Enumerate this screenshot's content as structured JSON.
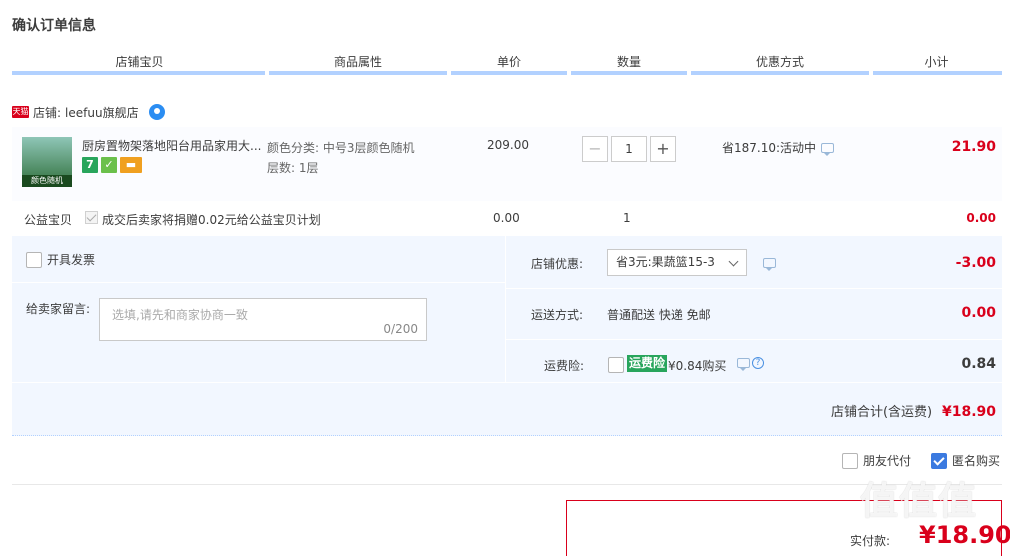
{
  "page_title": "确认订单信息",
  "columns": [
    "店铺宝贝",
    "商品属性",
    "单价",
    "数量",
    "优惠方式",
    "小计"
  ],
  "shop": {
    "tmall_badge": "天猫",
    "label": "店铺:",
    "name": "leefuu旗舰店"
  },
  "item": {
    "image_caption": "颜色随机",
    "title": "厨房置物架落地阳台用品家用大...",
    "badge_seven": "7",
    "attr_color": "颜色分类: 中号3层颜色随机",
    "attr_layers": "层数: 1层",
    "price": "209.00",
    "quantity": "1",
    "minus": "−",
    "plus": "+",
    "promo": "省187.10:活动中",
    "subtotal": "21.90"
  },
  "charity": {
    "label": "公益宝贝",
    "desc": "成交后卖家将捐赠0.02元给公益宝贝计划",
    "price": "0.00",
    "qty": "1",
    "subtotal": "0.00"
  },
  "invoice_label": "开具发票",
  "message": {
    "label": "给卖家留言:",
    "placeholder": "选填,请先和商家协商一致",
    "counter": "0/200"
  },
  "shop_discount": {
    "label": "店铺优惠:",
    "selected": "省3元:果蔬篮15-3",
    "value": "-3.00"
  },
  "shipping": {
    "label": "运送方式:",
    "value": "普通配送 快递 免邮",
    "fee": "0.00"
  },
  "insurance": {
    "label": "运费险:",
    "tag": "运费险",
    "text": "¥0.84购买",
    "value": "0.84"
  },
  "shop_total": {
    "label": "店铺合计(含运费)",
    "value": "¥18.90"
  },
  "options": {
    "friend_pay": "朋友代付",
    "anonymous": "匿名购买",
    "anonymous_checked": true
  },
  "pay": {
    "label": "实付款:",
    "value": "¥18.90"
  },
  "watermark": "值值值"
}
